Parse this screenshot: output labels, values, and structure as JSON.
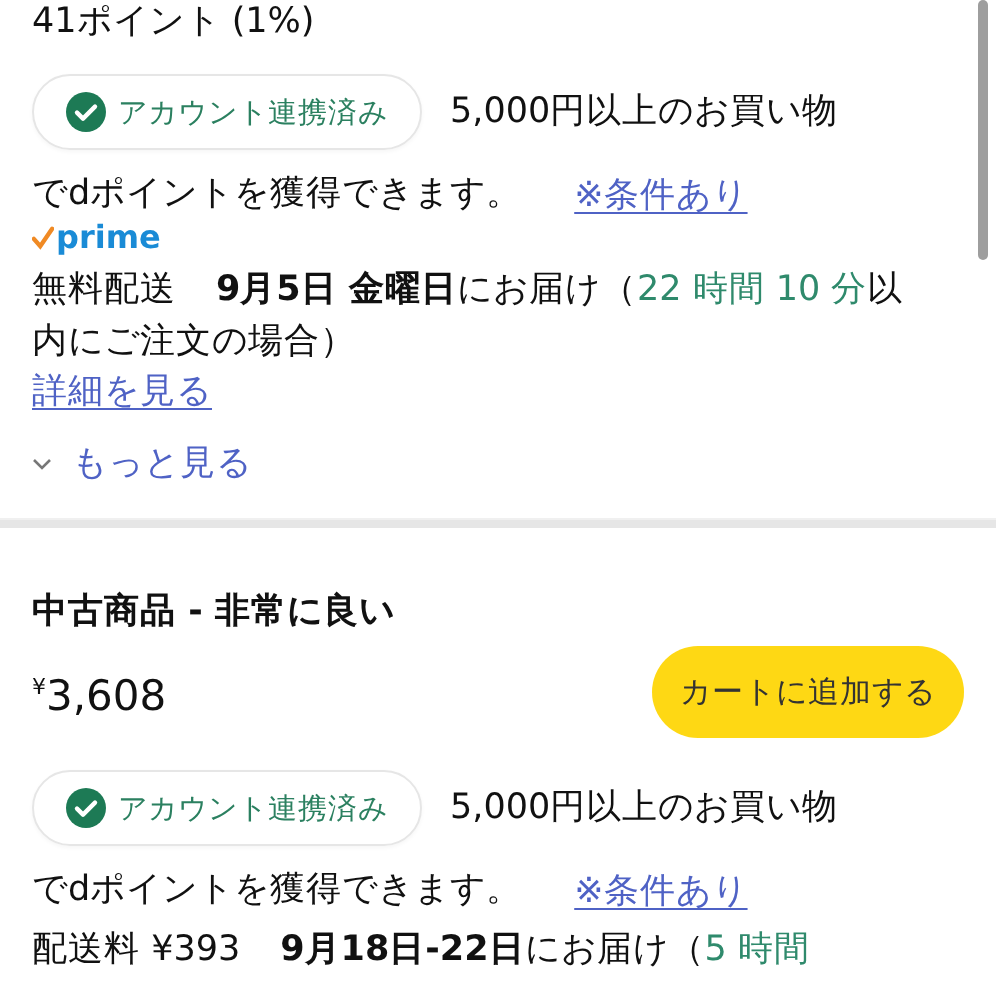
{
  "offers": [
    {
      "points": "41ポイント (1%)",
      "dpoint": {
        "badge": "アカウント連携済み",
        "text": "5,000円以上のお買い物",
        "text_cont": "でdポイントを獲得できます。",
        "link": "※条件あり"
      },
      "prime": "prime",
      "delivery": {
        "fee": "無料配送",
        "date": "9月5日 金曜日",
        "after": "にお届け（",
        "countdown": "22 時間 10 分",
        "end": "以内にご注文の場合）"
      },
      "details_link": "詳細を見る",
      "more_link": "もっと見る"
    },
    {
      "condition": "中古商品 - 非常に良い",
      "price": "$^{¥}$3,608",
      "cart_button": "カートに追加する",
      "dpoint": {
        "badge": "アカウント連携済み",
        "text": "5,000円以上のお買い物",
        "text_cont": "でdポイントを獲得できます。",
        "link": "※条件あり"
      },
      "delivery": {
        "fee": "配送料 ¥393",
        "date": "9月18日-22日",
        "after": "にお届け（",
        "countdown": "5 時間"
      }
    }
  ]
}
